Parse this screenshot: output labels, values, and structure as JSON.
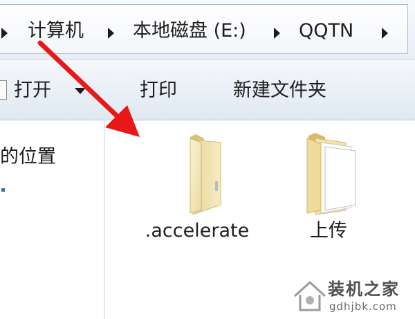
{
  "address_bar": {
    "crumbs": [
      "计算机",
      "本地磁盘 (E:)",
      "QQTN"
    ]
  },
  "toolbar": {
    "open_label": "打开",
    "print_label": "打印",
    "new_folder_label": "新建文件夹"
  },
  "nav_pane": {
    "partial_item": "的位置"
  },
  "content": {
    "items": [
      {
        "name": ".accelerate",
        "icon": "folder-icon"
      },
      {
        "name": "上传",
        "icon": "folder-with-files-icon"
      }
    ]
  },
  "annotation": {
    "arrow_color": "#e81818"
  },
  "watermark": {
    "title": "装机之家",
    "url": "gdhjbk.com"
  }
}
